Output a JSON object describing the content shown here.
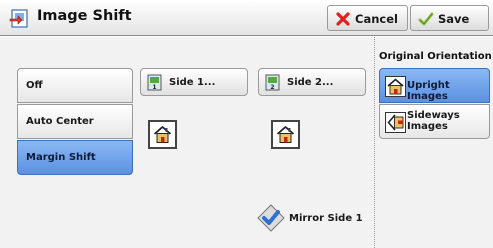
{
  "title": "Image Shift",
  "header": {
    "cancel_label": "Cancel",
    "save_label": "Save"
  },
  "shift_options": {
    "items": [
      {
        "label": "Off",
        "selected": false
      },
      {
        "label": "Auto Center",
        "selected": false
      },
      {
        "label": "Margin Shift",
        "selected": true
      }
    ]
  },
  "side_buttons": {
    "side1_label": "Side 1...",
    "side2_label": "Side 2..."
  },
  "mirror": {
    "label": "Mirror Side 1",
    "checked": true
  },
  "orientation": {
    "heading": "Original Orientation",
    "items": [
      {
        "label": "Upright Images",
        "selected": true
      },
      {
        "label": "Sideways Images",
        "selected": false
      }
    ]
  },
  "colors": {
    "selected_fill": "#6fa3ea",
    "cancel_x": "#e0201c",
    "save_check": "#8cc63f"
  },
  "icons": {
    "title": "image-shift-icon",
    "cancel": "x-icon",
    "save": "checkmark-icon",
    "side1": "side1-page-icon",
    "side2": "side2-page-icon",
    "preview": "house-icon",
    "mirror": "checkbox-check-icon",
    "upright": "upright-house-icon",
    "sideways": "sideways-house-icon"
  }
}
